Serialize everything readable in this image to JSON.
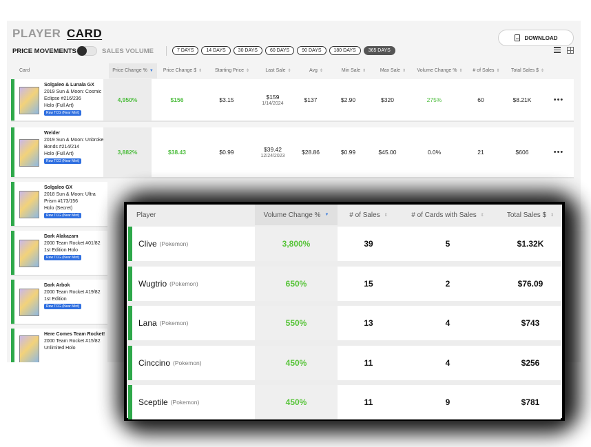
{
  "tabs": {
    "player": "PLAYER",
    "card": "CARD"
  },
  "download_label": "DOWNLOAD",
  "filters": {
    "price_movements": "PRICE MOVEMENTS",
    "sales_volume": "SALES VOLUME",
    "days": [
      "7 DAYS",
      "14 DAYS",
      "30 DAYS",
      "60 DAYS",
      "90 DAYS",
      "180 DAYS",
      "365 DAYS"
    ],
    "active_day": "365 DAYS"
  },
  "card_table": {
    "columns": [
      "Card",
      "Price Change %",
      "Price Change $",
      "Starting Price",
      "Last Sale",
      "Avg",
      "Min Sale",
      "Max Sale",
      "Volume Change %",
      "# of Sales",
      "Total Sales $"
    ],
    "rows": [
      {
        "name": "Solgaleo & Lunala GX",
        "set": "2019 Sun & Moon: Cosmic Eclipse #216/236",
        "variant": "Holo (Full Art)",
        "badge": "Raw TCG (Near Mint)",
        "price_change_pct": "4,950%",
        "price_change_usd": "$156",
        "starting_price": "$3.15",
        "last_sale": "$159",
        "last_sale_date": "1/14/2024",
        "avg": "$137",
        "min_sale": "$2.90",
        "max_sale": "$320",
        "volume_change": "275%",
        "num_sales": "60",
        "total_sales": "$8.21K"
      },
      {
        "name": "Welder",
        "set": "2019 Sun & Moon: Unbroken Bonds #214/214",
        "variant": "Holo (Full Art)",
        "badge": "Raw TCG (Near Mint)",
        "price_change_pct": "3,882%",
        "price_change_usd": "$38.43",
        "starting_price": "$0.99",
        "last_sale": "$39.42",
        "last_sale_date": "12/24/2023",
        "avg": "$28.86",
        "min_sale": "$0.99",
        "max_sale": "$45.00",
        "volume_change": "0.0%",
        "num_sales": "21",
        "total_sales": "$606"
      },
      {
        "name": "Solgaleo GX",
        "set": "2018 Sun & Moon: Ultra Prism #173/156",
        "variant": "Holo (Secret)",
        "badge": "Raw TCG (Near Mint)"
      },
      {
        "name": "Dark Alakazam",
        "set": "2000 Team Rocket #01/82",
        "variant": "1st Edition Holo",
        "badge": "Raw TCG (Near Mint)"
      },
      {
        "name": "Dark Arbok",
        "set": "2000 Team Rocket #19/82",
        "variant": "1st Edition",
        "badge": "Raw TCG (Near Mint)"
      },
      {
        "name": "Here Comes Team Rocket!",
        "set": "2000 Team Rocket #15/82",
        "variant": "Unlimited Holo",
        "badge": ""
      }
    ]
  },
  "player_table": {
    "columns": [
      "Player",
      "Volume Change %",
      "# of Sales",
      "# of Cards with Sales",
      "Total Sales $"
    ],
    "rows": [
      {
        "name": "Clive",
        "type": "(Pokemon)",
        "volume_change": "3,800%",
        "num_sales": "39",
        "num_cards": "5",
        "total_sales": "$1.32K"
      },
      {
        "name": "Wugtrio",
        "type": "(Pokemon)",
        "volume_change": "650%",
        "num_sales": "15",
        "num_cards": "2",
        "total_sales": "$76.09"
      },
      {
        "name": "Lana",
        "type": "(Pokemon)",
        "volume_change": "550%",
        "num_sales": "13",
        "num_cards": "4",
        "total_sales": "$743"
      },
      {
        "name": "Cinccino",
        "type": "(Pokemon)",
        "volume_change": "450%",
        "num_sales": "11",
        "num_cards": "4",
        "total_sales": "$256"
      },
      {
        "name": "Sceptile",
        "type": "(Pokemon)",
        "volume_change": "450%",
        "num_sales": "11",
        "num_cards": "9",
        "total_sales": "$781"
      }
    ]
  },
  "colors": {
    "accent_green": "#2ea84a",
    "value_green": "#4ebd3f",
    "sort_blue": "#3b7ddd",
    "badge_blue": "#2f6fe0"
  },
  "icons": [
    "download-icon",
    "list-view-icon",
    "grid-view-icon",
    "sort-icon",
    "more-icon"
  ]
}
